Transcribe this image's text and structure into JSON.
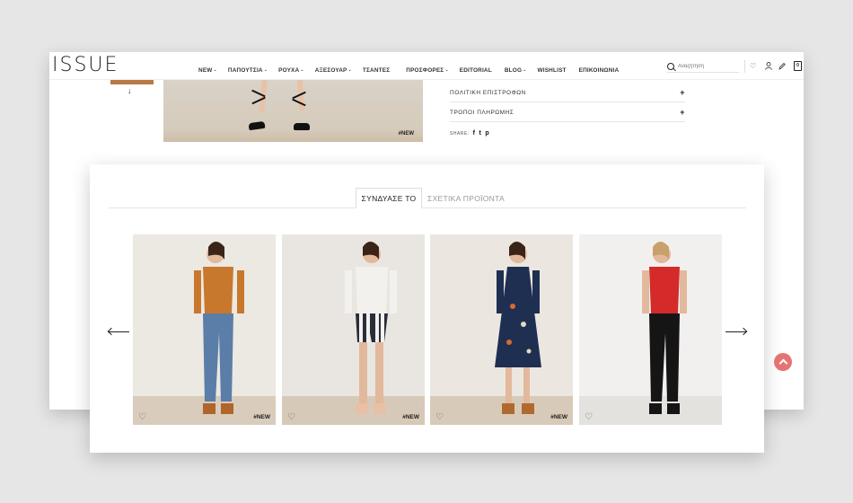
{
  "header": {
    "logo": "ISSUE",
    "nav": [
      {
        "label": "NEW",
        "dropdown": true
      },
      {
        "label": "ΠΑΠΟΥΤΣΙΑ",
        "dropdown": true
      },
      {
        "label": "ΡΟΥΧΑ",
        "dropdown": true
      },
      {
        "label": "ΑΞΕΣΟΥΑΡ",
        "dropdown": true
      },
      {
        "label": "ΤΣΑΝΤΕΣ",
        "dropdown": false
      },
      {
        "label": "ΠΡΟΣΦΟΡΕΣ",
        "dropdown": true
      },
      {
        "label": "EDITORIAL",
        "dropdown": false
      },
      {
        "label": "BLOG",
        "dropdown": true
      },
      {
        "label": "WISHLIST",
        "dropdown": false
      },
      {
        "label": "ΕΠΙΚΟΙΝΩΝΙΑ",
        "dropdown": false
      }
    ],
    "search_placeholder": "Αναζήτηση",
    "icons": [
      "heart-icon",
      "user-icon",
      "pencil-icon",
      "bag-icon"
    ],
    "cart_count": "0"
  },
  "product_detail": {
    "hero_tag": "#NEW",
    "accordion": [
      {
        "label": "ΠΟΛΙΤΙΚΗ ΕΠΙΣΤΡΟΦΩΝ",
        "icon": "+"
      },
      {
        "label": "ΤΡΟΠΟΙ ΠΛΗΡΩΜΗΣ",
        "icon": "+"
      }
    ],
    "share_label": "SHARE:",
    "share_icons": [
      "f",
      "t",
      "p"
    ]
  },
  "related": {
    "tabs": [
      {
        "label": "ΣΥΝΔΥΑΣΕ ΤΟ",
        "active": true
      },
      {
        "label": "ΣΧΕΤΙΚΑ ΠΡΟΪΟΝΤΑ",
        "active": false
      }
    ],
    "products": [
      {
        "tag": "#NEW",
        "bg": "#ece8e2",
        "floor": "#d9ccbc",
        "top": "#c8782c",
        "bottom": "#5a7ea8",
        "shoes": "#b0652a"
      },
      {
        "tag": "#NEW",
        "bg": "#e9e6e1",
        "floor": "#d7c9b7",
        "top": "#f3f1ee",
        "bottom": "#2a2d3a",
        "shoes": "#e8c0a5"
      },
      {
        "tag": "#NEW",
        "bg": "#ebe6df",
        "floor": "#d8cab8",
        "top": "#1f2f52",
        "bottom": "#1f2f52",
        "shoes": "#b06a30"
      },
      {
        "tag": "",
        "bg": "#f1f0ee",
        "floor": "#e4e2df",
        "top": "#d42a2a",
        "bottom": "#151515",
        "shoes": "#151515"
      }
    ]
  },
  "colors": {
    "scroll_top": "#e57373",
    "accent_text": "#222222"
  }
}
